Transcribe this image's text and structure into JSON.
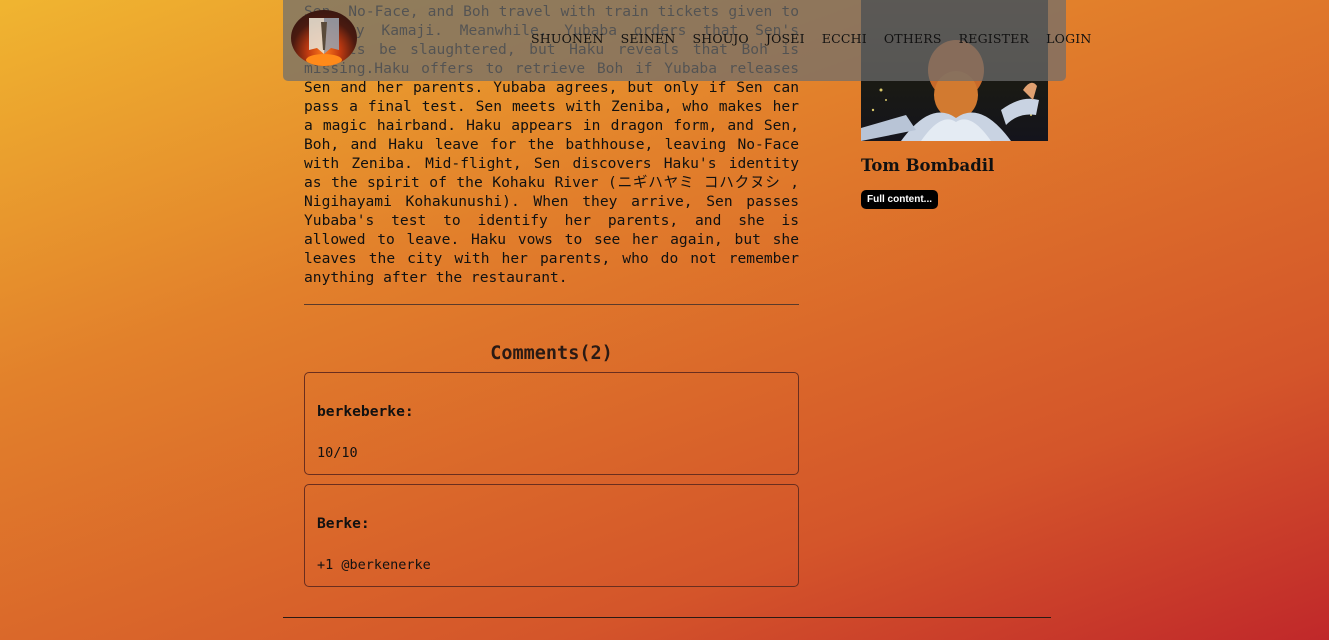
{
  "article": {
    "text": "Sen, No-Face, and Boh travel with train tickets given to her by Kamaji. Meanwhile, Yubaba orders that Sen's parents be slaughtered, but Haku reveals that Boh is missing.Haku offers to retrieve Boh if Yubaba releases Sen and her parents. Yubaba agrees, but only if Sen can pass a final test. Sen meets with Zeniba, who makes her a magic hairband. Haku appears in dragon form, and Sen, Boh, and Haku leave for the bathhouse, leaving No-Face with Zeniba. Mid-flight, Sen discovers Haku's identity as the spirit of the Kohaku River (ニギハヤミ コハクヌシ , Nigihayami Kohakunushi). When they arrive, Sen passes Yubaba's test to identify her parents, and she is allowed to leave. Haku vows to see her again, but she leaves the city with her parents, who do not remember anything after the restaurant."
  },
  "comments": {
    "title": "Comments(2)",
    "items": [
      {
        "author": "berkeberke:",
        "body": "10/10"
      },
      {
        "author": "Berke:",
        "body": "+1 @berkenerke"
      }
    ]
  },
  "nav": {
    "items": [
      "SHUONEN",
      "SEINEN",
      "SHOUJO",
      "JOSEI",
      "ECCHI",
      "OTHERS",
      "REGISTER",
      "LOGIN"
    ]
  },
  "sidebar": {
    "name": "Tom Bombadil",
    "button": "Full content..."
  },
  "colors": {
    "background_top": "#f0b530",
    "background_bottom": "#c0282a",
    "navbar": "#6e6e6e",
    "button": "#000000"
  }
}
